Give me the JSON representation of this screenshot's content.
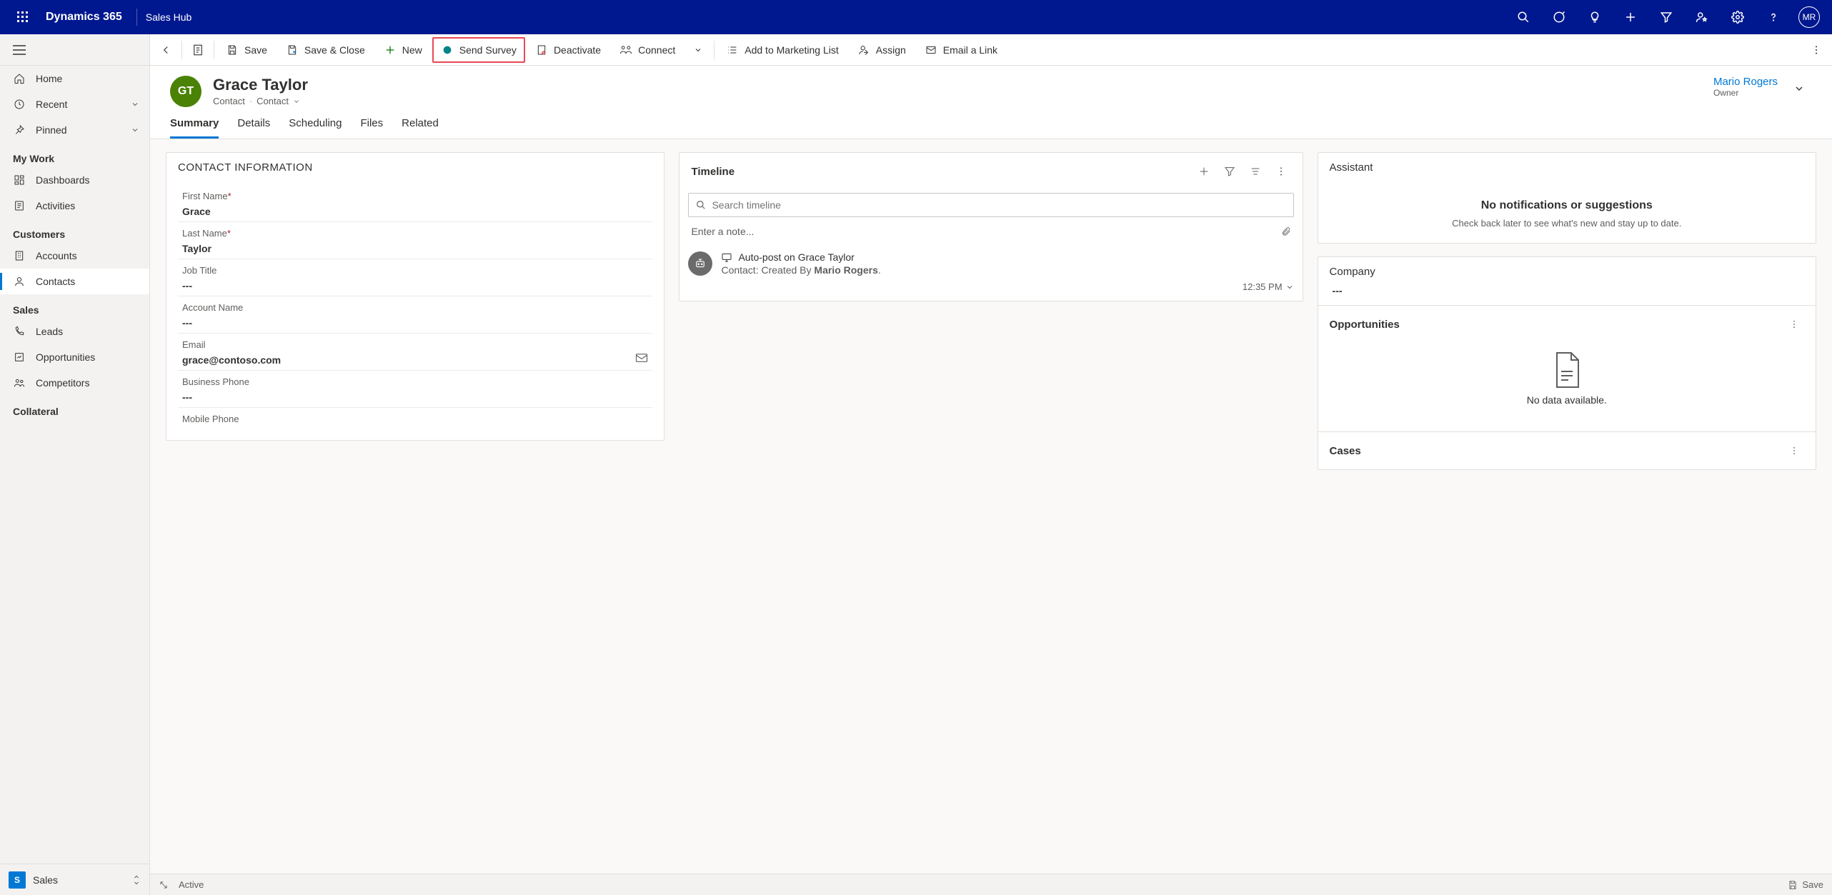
{
  "topnav": {
    "brand": "Dynamics 365",
    "hub": "Sales Hub",
    "user_initials": "MR"
  },
  "sidebar": {
    "items_top": [
      {
        "icon": "home",
        "label": "Home",
        "chevron": false
      },
      {
        "icon": "recent",
        "label": "Recent",
        "chevron": true
      },
      {
        "icon": "pin",
        "label": "Pinned",
        "chevron": true
      }
    ],
    "section_mywork": "My Work",
    "items_mywork": [
      {
        "icon": "dashboard",
        "label": "Dashboards"
      },
      {
        "icon": "activity",
        "label": "Activities"
      }
    ],
    "section_customers": "Customers",
    "items_customers": [
      {
        "icon": "account",
        "label": "Accounts",
        "active": false
      },
      {
        "icon": "contact",
        "label": "Contacts",
        "active": true
      }
    ],
    "section_sales": "Sales",
    "items_sales": [
      {
        "icon": "lead",
        "label": "Leads"
      },
      {
        "icon": "opportunity",
        "label": "Opportunities"
      },
      {
        "icon": "competitor",
        "label": "Competitors"
      }
    ],
    "section_collateral": "Collateral",
    "area_badge": "S",
    "area_label": "Sales"
  },
  "commands": {
    "save": "Save",
    "save_close": "Save & Close",
    "new": "New",
    "send_survey": "Send Survey",
    "deactivate": "Deactivate",
    "connect": "Connect",
    "add_marketing": "Add to Marketing List",
    "assign": "Assign",
    "email_link": "Email a Link"
  },
  "header": {
    "avatar_initials": "GT",
    "title": "Grace Taylor",
    "entity": "Contact",
    "form": "Contact",
    "owner_name": "Mario Rogers",
    "owner_label": "Owner"
  },
  "tabs": [
    "Summary",
    "Details",
    "Scheduling",
    "Files",
    "Related"
  ],
  "active_tab": "Summary",
  "contact_info": {
    "section_title": "CONTACT INFORMATION",
    "fields": {
      "first_name": {
        "label": "First Name",
        "required": true,
        "value": "Grace"
      },
      "last_name": {
        "label": "Last Name",
        "required": true,
        "value": "Taylor"
      },
      "job_title": {
        "label": "Job Title",
        "required": false,
        "value": "---"
      },
      "account_name": {
        "label": "Account Name",
        "required": false,
        "value": "---"
      },
      "email": {
        "label": "Email",
        "required": false,
        "value": "grace@contoso.com"
      },
      "business_phone": {
        "label": "Business Phone",
        "required": false,
        "value": "---"
      },
      "mobile_phone": {
        "label": "Mobile Phone",
        "required": false,
        "value": ""
      }
    }
  },
  "timeline": {
    "title": "Timeline",
    "search_placeholder": "Search timeline",
    "note_placeholder": "Enter a note...",
    "item": {
      "title_prefix": "Auto-post on ",
      "title_subject": "Grace Taylor",
      "sub_prefix": "Contact: Created By ",
      "sub_author": "Mario Rogers",
      "sub_suffix": ".",
      "time": "12:35 PM"
    }
  },
  "assistant": {
    "title": "Assistant",
    "heading": "No notifications or suggestions",
    "sub": "Check back later to see what's new and stay up to date."
  },
  "right": {
    "company_label": "Company",
    "company_value": "---",
    "opportunities_label": "Opportunities",
    "no_data": "No data available.",
    "cases_label": "Cases"
  },
  "statusbar": {
    "active": "Active",
    "save": "Save"
  }
}
